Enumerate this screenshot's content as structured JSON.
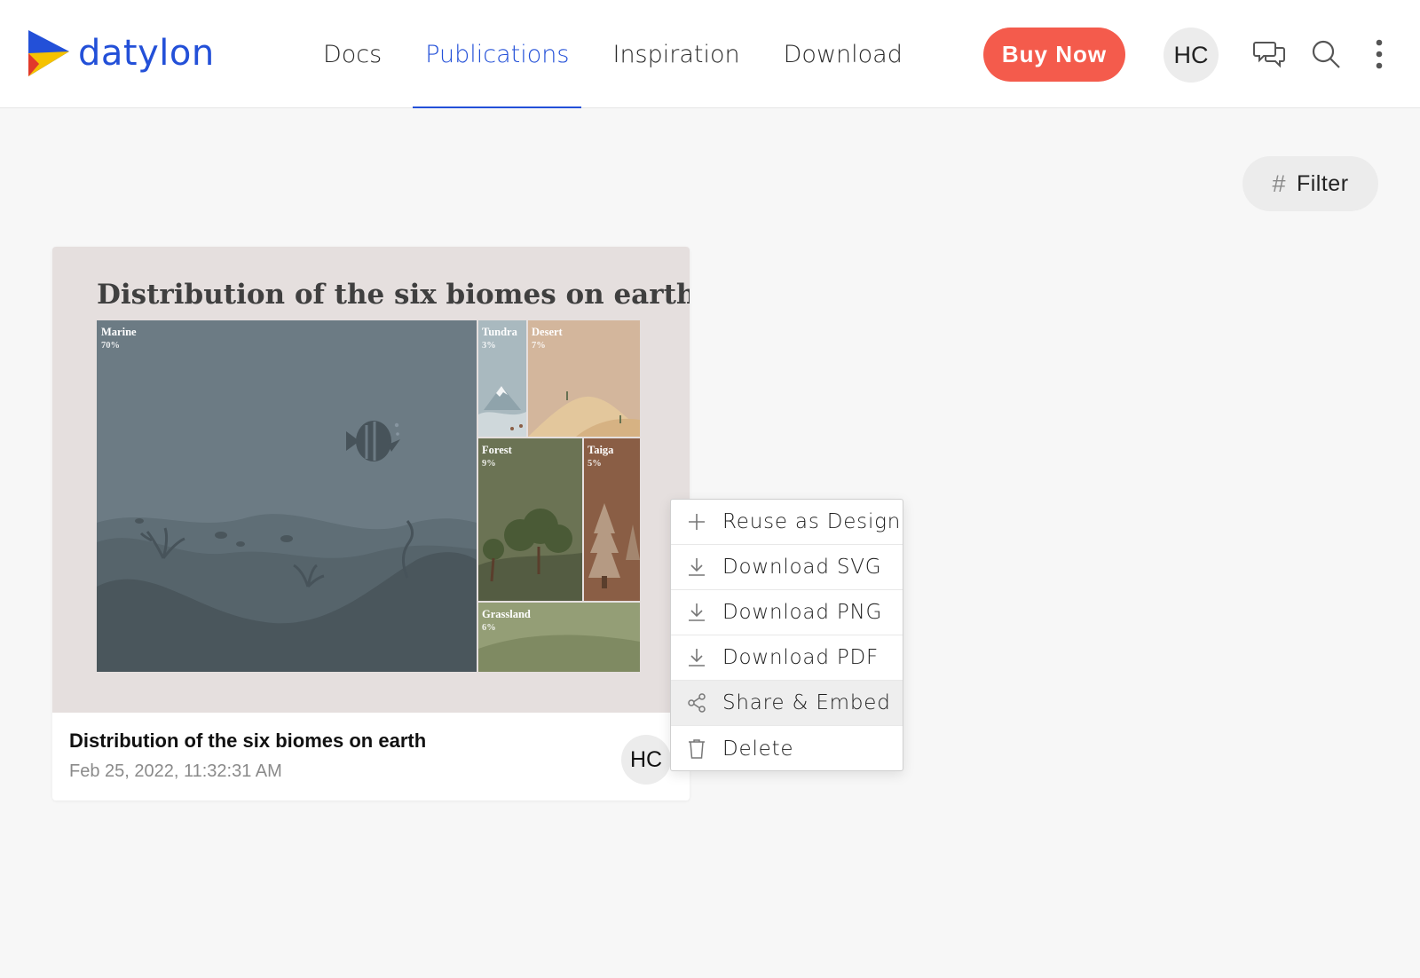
{
  "header": {
    "logo_text": "datylon",
    "nav": [
      {
        "label": "Docs",
        "active": false
      },
      {
        "label": "Publications",
        "active": true
      },
      {
        "label": "Inspiration",
        "active": false
      },
      {
        "label": "Download",
        "active": false
      }
    ],
    "buy_label": "Buy Now",
    "avatar_initials": "HC",
    "icons": [
      "chat-icon",
      "search-icon",
      "more-vertical-icon"
    ]
  },
  "toolbar": {
    "filter_label": "Filter",
    "filter_icon": "hash-icon"
  },
  "card": {
    "thumbnail_title": "Distribution of the six biomes on earth",
    "title": "Distribution of the six biomes on earth",
    "date": "Feb 25, 2022, 11:32:31 AM",
    "avatar_initials": "HC"
  },
  "chart_data": {
    "type": "treemap",
    "title": "Distribution of the six biomes on earth",
    "items": [
      {
        "label": "Marine",
        "value": "70%",
        "color": "#6c7b84"
      },
      {
        "label": "Tundra",
        "value": "3%",
        "color": "#a9b9bf"
      },
      {
        "label": "Desert",
        "value": "7%",
        "color": "#d3b69c"
      },
      {
        "label": "Forest",
        "value": "9%",
        "color": "#6b7354"
      },
      {
        "label": "Taiga",
        "value": "5%",
        "color": "#8a5e45"
      },
      {
        "label": "Grassland",
        "value": "6%",
        "color": "#949e76"
      }
    ]
  },
  "menu": {
    "items": [
      {
        "label": "Reuse as Design",
        "icon": "plus-icon"
      },
      {
        "label": "Download SVG",
        "icon": "download-icon"
      },
      {
        "label": "Download PNG",
        "icon": "download-icon"
      },
      {
        "label": "Download PDF",
        "icon": "download-icon"
      },
      {
        "label": "Share & Embed",
        "icon": "share-icon",
        "hovered": true
      },
      {
        "label": "Delete",
        "icon": "trash-icon"
      }
    ]
  },
  "colors": {
    "accent": "#2350d8",
    "buy_button": "#f45b4c"
  }
}
